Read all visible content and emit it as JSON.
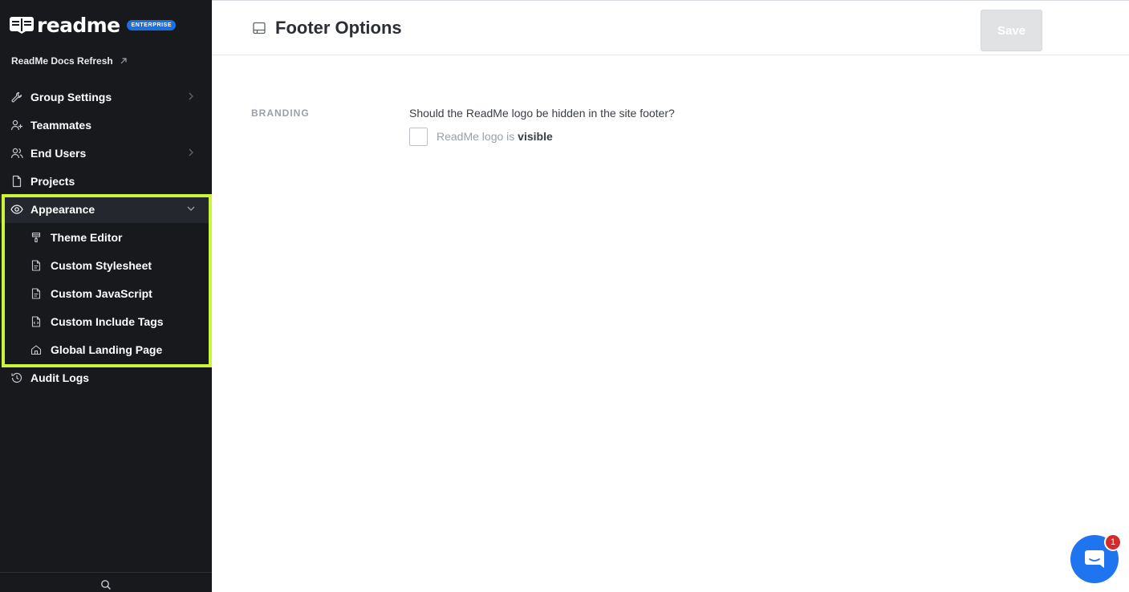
{
  "brand": {
    "name": "readme",
    "badge": "ENTERPRISE"
  },
  "project": {
    "name": "ReadMe Docs Refresh"
  },
  "sidebar": {
    "items": [
      {
        "label": "Group Settings",
        "icon": "wrench-icon",
        "has_chevron": true
      },
      {
        "label": "Teammates",
        "icon": "add-user-icon"
      },
      {
        "label": "End Users",
        "icon": "users-icon",
        "has_chevron": true
      },
      {
        "label": "Projects",
        "icon": "file-icon"
      },
      {
        "label": "Appearance",
        "icon": "eye-icon",
        "expanded": true
      },
      {
        "label": "Audit Logs",
        "icon": "history-icon"
      }
    ],
    "appearance_sub": [
      {
        "label": "Theme Editor",
        "icon": "paintbrush-icon"
      },
      {
        "label": "Custom Stylesheet",
        "icon": "css-file-icon"
      },
      {
        "label": "Custom JavaScript",
        "icon": "js-file-icon"
      },
      {
        "label": "Custom Include Tags",
        "icon": "code-file-icon"
      },
      {
        "label": "Global Landing Page",
        "icon": "home-icon"
      }
    ],
    "highlight_color": "#cbf53c"
  },
  "header": {
    "title": "Footer Options",
    "save_label": "Save"
  },
  "content": {
    "section_label": "BRANDING",
    "question": "Should the ReadMe logo be hidden in the site footer?",
    "checkbox_prefix": "ReadMe logo is",
    "checkbox_state": "visible",
    "checked": false
  },
  "chat": {
    "badge_count": "1"
  },
  "colors": {
    "sidebar_bg": "#17191d",
    "accent": "#1f74f0",
    "badge": "#d52b2b"
  }
}
